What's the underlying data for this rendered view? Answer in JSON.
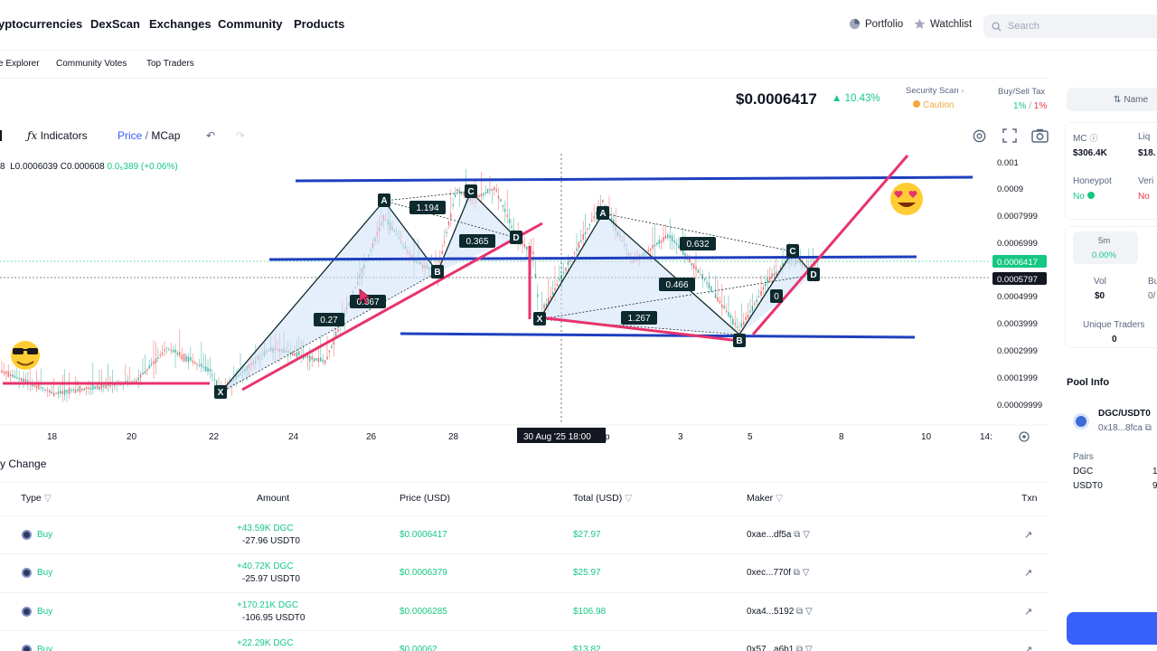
{
  "nav": {
    "items": [
      "yptocurrencies",
      "DexScan",
      "Exchanges",
      "Community",
      "Products"
    ],
    "portfolio": "Portfolio",
    "watchlist": "Watchlist",
    "search_placeholder": "Search"
  },
  "subnav": [
    "e Explorer",
    "Community Votes",
    "Top Traders"
  ],
  "header": {
    "price": "$0.0006417",
    "change": "▲ 10.43%",
    "security_label": "Security Scan",
    "security_value": "Caution",
    "tax_label": "Buy/Sell Tax",
    "tax_buy": "1%",
    "tax_sep": " / ",
    "tax_sell": "1%"
  },
  "toolbar": {
    "indicators": "Indicators",
    "price": "Price",
    "slash": " / ",
    "mcap": "MCap"
  },
  "ohlc": {
    "lead": "8",
    "low": "L0.0006039",
    "close": "C0.000608",
    "change": "0.0₅389 (+0.06%)"
  },
  "chart_data": {
    "type": "line",
    "y_ticks": [
      "0.001",
      "0.0009",
      "0.0007999",
      "0.0006999",
      "0.0006417",
      "0.0005797",
      "0.0004999",
      "0.0003999",
      "0.0002999",
      "0.0001999",
      "0.00009999"
    ],
    "x_ticks": [
      "18",
      "20",
      "22",
      "24",
      "26",
      "28",
      "30 Aug '25   18:00",
      "p",
      "3",
      "5",
      "8",
      "10",
      "14:"
    ],
    "current_price_label": "0.0006417",
    "crosshair_price_label": "0.0005797",
    "pattern_points": [
      "X",
      "A",
      "B",
      "C",
      "D",
      "X",
      "A",
      "B",
      "C",
      "D"
    ],
    "ratios": [
      "1.194",
      "0.365",
      "0.27",
      "0.367",
      "0.632",
      "0.466",
      "1.267"
    ],
    "colors": {
      "support": "#1e3fbf",
      "trend": "#e8336d",
      "pattern_fill": "#cfe0f7"
    }
  },
  "right_panel": {
    "name_tab": "Name",
    "mc_label": "MC",
    "mc_value": "$306.4K",
    "liq_label": "Liq",
    "liq_value": "$18.",
    "honeypot_label": "Honeypot",
    "honeypot_value": "No",
    "verified_label": "Veri",
    "verified_value": "No",
    "tf_label": "5m",
    "tf_value": "0.00%",
    "vol_label": "Vol",
    "vol_value": "$0",
    "bu_label": "Bu",
    "bu_value": "0/",
    "unique_label": "Unique Traders",
    "unique_value": "0",
    "pool_title": "Pool Info",
    "pair_name": "DGC/USDT0",
    "pair_addr": "0x18...8fca",
    "pairs_label": "Pairs",
    "pair_a": "DGC",
    "pair_b": "USDT0",
    "pair_a_val": "1",
    "pair_b_val": "9"
  },
  "table": {
    "section_title": "y Change",
    "headers": {
      "type": "Type",
      "amount": "Amount",
      "price": "Price (USD)",
      "total": "Total (USD)",
      "maker": "Maker",
      "txn": "Txn"
    },
    "rows": [
      {
        "type": "Buy",
        "amt1": "+43.59K DGC",
        "amt2": "-27.96 USDT0",
        "price": "$0.0006417",
        "total": "$27.97",
        "maker": "0xae...df5a"
      },
      {
        "type": "Buy",
        "amt1": "+40.72K DGC",
        "amt2": "-25.97 USDT0",
        "price": "$0.0006379",
        "total": "$25.97",
        "maker": "0xec...770f"
      },
      {
        "type": "Buy",
        "amt1": "+170.21K DGC",
        "amt2": "-106.95 USDT0",
        "price": "$0.0006285",
        "total": "$106.98",
        "maker": "0xa4...5192"
      },
      {
        "type": "Buy",
        "amt1": "+22.29K DGC",
        "amt2": "",
        "price": "$0.00062",
        "total": "$13.82",
        "maker": "0x57...a6b1"
      }
    ]
  }
}
